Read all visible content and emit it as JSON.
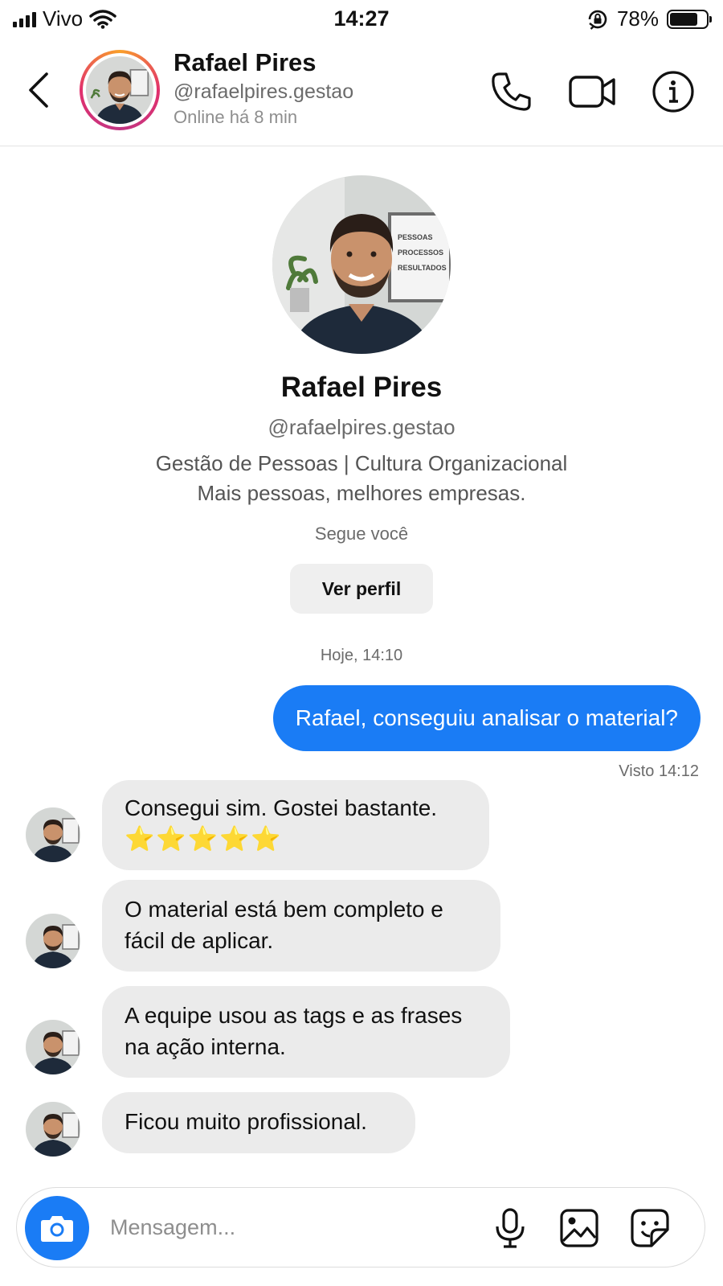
{
  "status_bar": {
    "carrier": "Vivo",
    "time": "14:27",
    "battery_percent": "78%",
    "battery_level": 0.78,
    "icons": [
      "signal-icon",
      "wifi-icon",
      "orientation-lock-icon",
      "battery-icon"
    ]
  },
  "header": {
    "name": "Rafael Pires",
    "handle": "@rafaelpires.gestao",
    "online_status": "Online há 8 min",
    "icons": [
      "back-icon",
      "phone-icon",
      "video-icon",
      "info-icon"
    ]
  },
  "profile": {
    "name": "Rafael Pires",
    "handle": "@rafaelpires.gestao",
    "bio_line1": "Gestão de Pessoas | Cultura Organizacional",
    "bio_line2": "Mais pessoas, melhores empresas.",
    "follows_you": "Segue você",
    "view_profile_label": "Ver perfil",
    "avatar_sign_lines": [
      "PESSOAS",
      "PROCESSOS",
      "RESULTADOS"
    ]
  },
  "conversation": {
    "timestamp": "Hoje, 14:10",
    "outgoing": [
      {
        "text": "Rafael, conseguiu analisar o material?",
        "seen": "Visto 14:12"
      }
    ],
    "incoming": [
      {
        "line1": "Consegui sim. Gostei bastante.",
        "line2": "⭐⭐⭐⭐⭐",
        "stars": 5
      },
      {
        "line1": "O material está bem completo e",
        "line2": "fácil de aplicar."
      },
      {
        "line1": "A equipe usou as tags e as frases",
        "line2": "na ação interna."
      },
      {
        "line1": "Ficou muito profissional."
      }
    ]
  },
  "composer": {
    "placeholder": "Mensagem...",
    "icons": [
      "camera-icon",
      "microphone-icon",
      "gallery-icon",
      "sticker-icon"
    ]
  },
  "colors": {
    "accent": "#1a7cf5",
    "incoming_bubble": "#ebebeb",
    "secondary_text": "#6b6b6b",
    "ring_gradient": [
      "#f9a02a",
      "#e1306c",
      "#c13584"
    ]
  }
}
